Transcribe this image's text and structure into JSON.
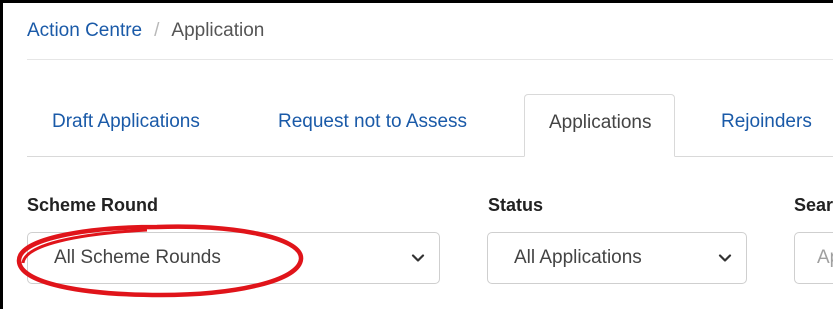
{
  "breadcrumb": {
    "parent": "Action Centre",
    "separator": "/",
    "current": "Application"
  },
  "tabs": [
    {
      "label": "Draft Applications",
      "active": false
    },
    {
      "label": "Request not to Assess",
      "active": false
    },
    {
      "label": "Applications",
      "active": true
    },
    {
      "label": "Rejoinders",
      "active": false
    }
  ],
  "filters": {
    "scheme_round": {
      "label": "Scheme Round",
      "value": "All Scheme Rounds"
    },
    "status": {
      "label": "Status",
      "value": "All Applications"
    },
    "search": {
      "label": "Sear",
      "placeholder": "Ap"
    }
  },
  "colors": {
    "link": "#1a5aa8",
    "annotation": "#e0141a"
  },
  "icons": {
    "dropdown": "chevron-down-icon"
  }
}
